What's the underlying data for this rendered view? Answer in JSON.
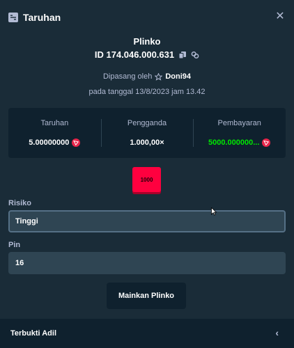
{
  "modal": {
    "title": "Taruhan",
    "close_icon": "close-icon"
  },
  "bet": {
    "game": "Plinko",
    "id_text": "ID 174.046.000.631",
    "placed_by_label": "Dipasang oleh",
    "user": "Doni94",
    "date_text": "pada tanggal 13/8/2023 jam 13.42"
  },
  "stats": {
    "bet_label": "Taruhan",
    "bet_value": "5.00000000",
    "multiplier_label": "Pengganda",
    "multiplier_value": "1.000,00×",
    "payout_label": "Pembayaran",
    "payout_value": "5000.000000..."
  },
  "result_chip": "1000",
  "risk": {
    "label": "Risiko",
    "value": "Tinggi"
  },
  "pins": {
    "label": "Pin",
    "value": "16"
  },
  "play_button": "Mainkan Plinko",
  "footer": {
    "label": "Terbukti Adil",
    "chevron_icon": "chevron-left-icon"
  },
  "colors": {
    "background": "#1a2c38",
    "panel": "#0f212e",
    "input": "#2f4553",
    "payout_green": "#00e701",
    "chip_red": "#ff003f",
    "muted_text": "#b1bad3",
    "coin": "#e8254a"
  }
}
